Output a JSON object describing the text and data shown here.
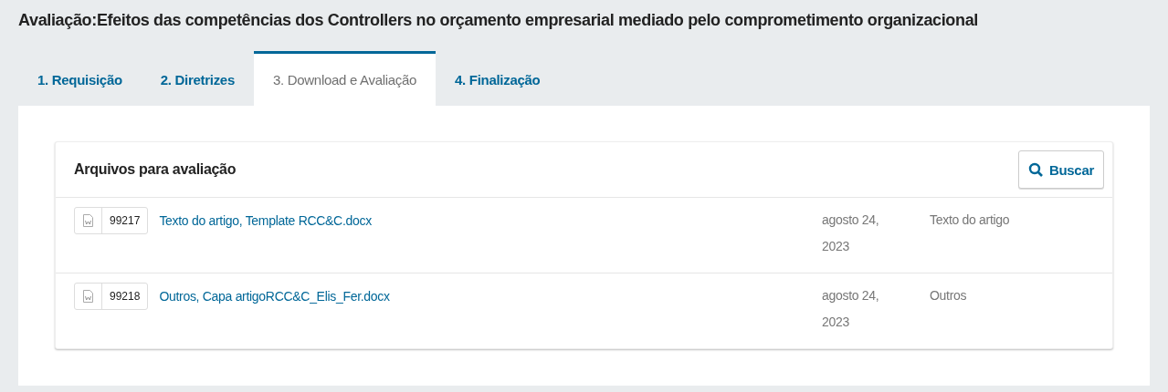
{
  "page_title": "Avaliação:Efeitos das competências dos Controllers no orçamento empresarial mediado pelo comprometimento organizacional",
  "tabs": [
    {
      "label": "1. Requisição",
      "selected": false
    },
    {
      "label": "2. Diretrizes",
      "selected": false
    },
    {
      "label": "3. Download e Avaliação",
      "selected": true
    },
    {
      "label": "4. Finalização",
      "selected": false
    }
  ],
  "files_panel": {
    "title": "Arquivos para avaliação",
    "search_button": "Buscar",
    "rows": [
      {
        "id": "99217",
        "name": "Texto do artigo, Template RCC&C.docx",
        "date": "agosto 24, 2023",
        "genre": "Texto do artigo"
      },
      {
        "id": "99218",
        "name": "Outros, Capa artigoRCC&C_Elis_Fer.docx",
        "date": "agosto 24, 2023",
        "genre": "Outros"
      }
    ]
  }
}
